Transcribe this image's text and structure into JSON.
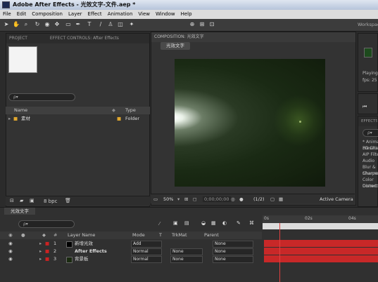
{
  "window": {
    "title": "Adobe After Effects - 光效文字-文件.aep *"
  },
  "menu": [
    "File",
    "Edit",
    "Composition",
    "Layer",
    "Effect",
    "Animation",
    "View",
    "Window",
    "Help"
  ],
  "toolbar": {
    "workspace_label": "Workspace"
  },
  "project_panel": {
    "tab_project": "PROJECT",
    "tab_effect_controls": "EFFECT CONTROLS: After Effects",
    "search_placeholder": "ρ▾",
    "columns": {
      "name": "Name",
      "type": "Type"
    },
    "items": [
      {
        "name": "素材",
        "type": "Folder"
      }
    ],
    "bpc": "8 bpc"
  },
  "composition_panel": {
    "tab": "COMPOSITION: 光效文字",
    "comp_button": "光效文字",
    "zoom": "50%",
    "timecode": "0;00;00;00",
    "resolution": "(1/2)",
    "camera": "Active Camera"
  },
  "info_panel": {
    "playing_label": "Playing",
    "fps_label": "fps: 25"
  },
  "effects_panel": {
    "tab": "EFFECTS & PRESETS",
    "search_placeholder": "ρ▾",
    "items": [
      "* Animation Presets",
      "3D Channel",
      "AIP Filters",
      "Audio",
      "Blur & Sharpen",
      "Channel",
      "Color Correction",
      "Distort"
    ]
  },
  "timeline": {
    "tab": "光效文字",
    "search_placeholder": "ρ▾",
    "columns": {
      "layer_name": "Layer Name",
      "mode": "Mode",
      "trkmat": "TrkMat",
      "parent": "Parent"
    },
    "layers": [
      {
        "num": "1",
        "name": "新增光效",
        "mode": "Add",
        "trkmat": "",
        "parent": "None",
        "color": "#cc2222"
      },
      {
        "num": "2",
        "name": "After Effects",
        "mode": "Normal",
        "trkmat": "None",
        "parent": "None",
        "color": "#cc2222"
      },
      {
        "num": "3",
        "name": "背景板",
        "mode": "Normal",
        "trkmat": "None",
        "parent": "None",
        "color": "#cc2222"
      }
    ],
    "ruler_labels": [
      "0s",
      "02s",
      "04s"
    ]
  }
}
